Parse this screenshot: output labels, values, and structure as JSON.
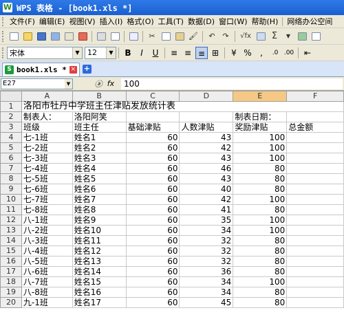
{
  "window": {
    "app_logo": "W",
    "title": "WPS 表格 - [book1.xls *]"
  },
  "menu": [
    "文件(F)",
    "编辑(E)",
    "视图(V)",
    "插入(I)",
    "格式(O)",
    "工具(T)",
    "数据(D)",
    "窗口(W)",
    "帮助(H)",
    "网络办公空间"
  ],
  "format_bar": {
    "font_name": "宋体",
    "font_size": "12",
    "bold": "B",
    "italic": "I",
    "underline": "U",
    "percent": "%",
    "thousands": ",",
    "sigma": "Σ"
  },
  "tab": {
    "label": "book1.xls *",
    "close": "×",
    "new": "+"
  },
  "formula_bar": {
    "cell_ref": "E27",
    "value": "100",
    "fx": "fx"
  },
  "sheet": {
    "columns": [
      "A",
      "B",
      "C",
      "D",
      "E",
      "F"
    ],
    "row_numbers": [
      "1",
      "2",
      "3",
      "4",
      "5",
      "6",
      "7",
      "8",
      "9",
      "10",
      "11",
      "12",
      "13",
      "14",
      "15",
      "16",
      "17",
      "18",
      "19",
      "20"
    ],
    "title": "洛阳市牡丹中学班主任津贴发放统计表",
    "maker_label": "制表人：",
    "maker_name": "洛阳阿笑",
    "date_label": "制表日期：",
    "headers": [
      "班级",
      "班主任",
      "基础津贴",
      "人数津贴",
      "奖励津贴",
      "总金额"
    ],
    "rows": [
      [
        "七-1班",
        "姓名1",
        "60",
        "43",
        "100",
        ""
      ],
      [
        "七-2班",
        "姓名2",
        "60",
        "42",
        "100",
        ""
      ],
      [
        "七-3班",
        "姓名3",
        "60",
        "43",
        "100",
        ""
      ],
      [
        "七-4班",
        "姓名4",
        "60",
        "46",
        "80",
        ""
      ],
      [
        "七-5班",
        "姓名5",
        "60",
        "43",
        "80",
        ""
      ],
      [
        "七-6班",
        "姓名6",
        "60",
        "40",
        "80",
        ""
      ],
      [
        "七-7班",
        "姓名7",
        "60",
        "42",
        "100",
        ""
      ],
      [
        "七-8班",
        "姓名8",
        "60",
        "41",
        "80",
        ""
      ],
      [
        "八-1班",
        "姓名9",
        "60",
        "35",
        "100",
        ""
      ],
      [
        "八-2班",
        "姓名10",
        "60",
        "34",
        "100",
        ""
      ],
      [
        "八-3班",
        "姓名11",
        "60",
        "32",
        "80",
        ""
      ],
      [
        "八-4班",
        "姓名12",
        "60",
        "32",
        "80",
        ""
      ],
      [
        "八-5班",
        "姓名13",
        "60",
        "32",
        "80",
        ""
      ],
      [
        "八-6班",
        "姓名14",
        "60",
        "36",
        "80",
        ""
      ],
      [
        "八-7班",
        "姓名15",
        "60",
        "34",
        "100",
        ""
      ],
      [
        "八-8班",
        "姓名16",
        "60",
        "34",
        "80",
        ""
      ],
      [
        "九-1班",
        "姓名17",
        "60",
        "45",
        "80",
        ""
      ]
    ]
  }
}
